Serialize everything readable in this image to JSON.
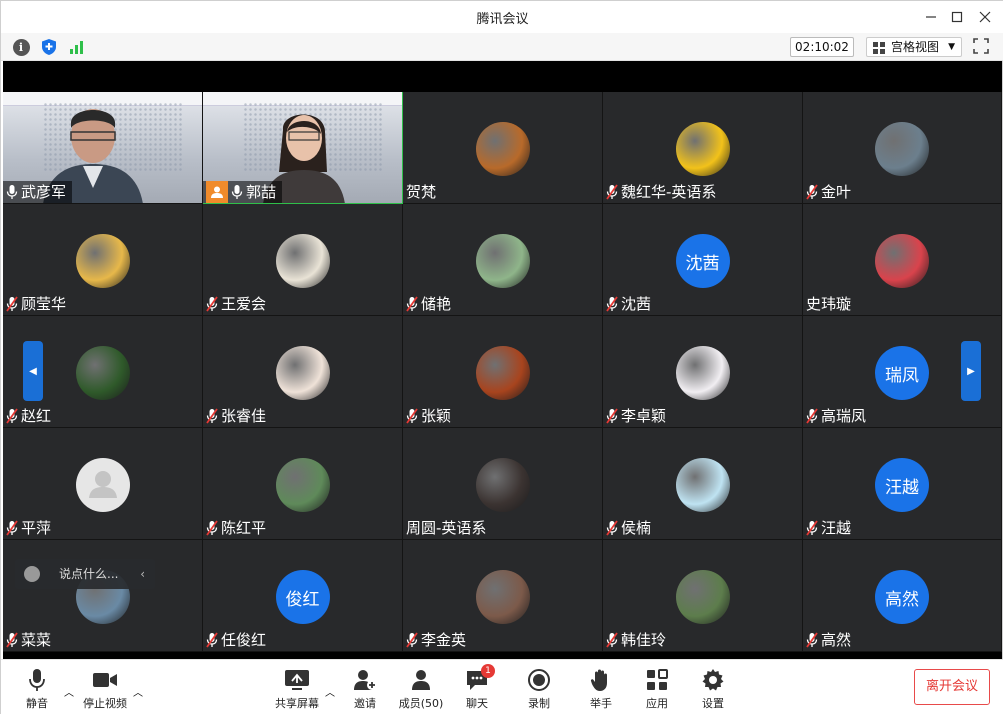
{
  "window": {
    "title": "腾讯会议"
  },
  "toolbar": {
    "timer": "02:10:02",
    "view_label": "宫格视图"
  },
  "participants": [
    {
      "name": "武彦军",
      "type": "video",
      "mic": "on"
    },
    {
      "name": "郭喆",
      "type": "video",
      "mic": "on",
      "host": true,
      "active": true
    },
    {
      "name": "贺梵",
      "type": "photo",
      "mic": "none",
      "color": "#b86a2a"
    },
    {
      "name": "魏红华-英语系",
      "type": "photo",
      "mic": "muted",
      "color": "#f2c21a"
    },
    {
      "name": "金叶",
      "type": "photo",
      "mic": "muted",
      "color": "#6c7f8d"
    },
    {
      "name": "顾莹华",
      "type": "photo",
      "mic": "muted",
      "color": "#e7b84a"
    },
    {
      "name": "王爱会",
      "type": "photo",
      "mic": "muted",
      "color": "#e9e3d6"
    },
    {
      "name": "储艳",
      "type": "photo",
      "mic": "muted",
      "color": "#8fb58a"
    },
    {
      "name": "沈茜",
      "type": "text",
      "mic": "muted",
      "avatar_text": "沈茜",
      "color": "#1a73e8"
    },
    {
      "name": "史玮璇",
      "type": "photo",
      "mic": "none",
      "color": "#d9434c"
    },
    {
      "name": "赵红",
      "type": "photo",
      "mic": "muted",
      "color": "#2f5a2a"
    },
    {
      "name": "张睿佳",
      "type": "photo",
      "mic": "muted",
      "color": "#efe2d8"
    },
    {
      "name": "张颖",
      "type": "photo",
      "mic": "muted",
      "color": "#a8441e"
    },
    {
      "name": "李卓颖",
      "type": "photo",
      "mic": "muted",
      "color": "#f1eef2"
    },
    {
      "name": "高瑞凤",
      "type": "text",
      "mic": "muted",
      "avatar_text": "瑞凤",
      "color": "#1a73e8"
    },
    {
      "name": "平萍",
      "type": "default",
      "mic": "muted",
      "color": "#e6e6e6"
    },
    {
      "name": "陈红平",
      "type": "photo",
      "mic": "muted",
      "color": "#5f8a5a"
    },
    {
      "name": "周圆-英语系",
      "type": "photo",
      "mic": "none",
      "color": "#3b3331"
    },
    {
      "name": "侯楠",
      "type": "photo",
      "mic": "muted",
      "color": "#bfe3f2"
    },
    {
      "name": "汪越",
      "type": "text",
      "mic": "muted",
      "avatar_text": "汪越",
      "color": "#1a73e8"
    },
    {
      "name": "菜菜",
      "type": "photo",
      "mic": "muted",
      "color": "#6a8aa5"
    },
    {
      "name": "任俊红",
      "type": "text",
      "mic": "muted",
      "avatar_text": "俊红",
      "color": "#1a73e8"
    },
    {
      "name": "李金英",
      "type": "photo",
      "mic": "muted",
      "color": "#7c5a4a"
    },
    {
      "name": "韩佳玲",
      "type": "photo",
      "mic": "muted",
      "color": "#5d7d4c"
    },
    {
      "name": "高然",
      "type": "text",
      "mic": "muted",
      "avatar_text": "高然",
      "color": "#1a73e8"
    }
  ],
  "chat": {
    "placeholder": "说点什么..."
  },
  "controls": {
    "mute": "静音",
    "stop_video": "停止视频",
    "share": "共享屏幕",
    "invite": "邀请",
    "members": "成员(50)",
    "chat": "聊天",
    "chat_badge": "1",
    "record": "录制",
    "raise_hand": "举手",
    "apps": "应用",
    "settings": "设置",
    "leave": "离开会议"
  },
  "colors": {
    "accent": "#1a73e8",
    "mic_muted": "#e53935",
    "active_speaker": "#2fbf4a",
    "host": "#f08b2b"
  }
}
